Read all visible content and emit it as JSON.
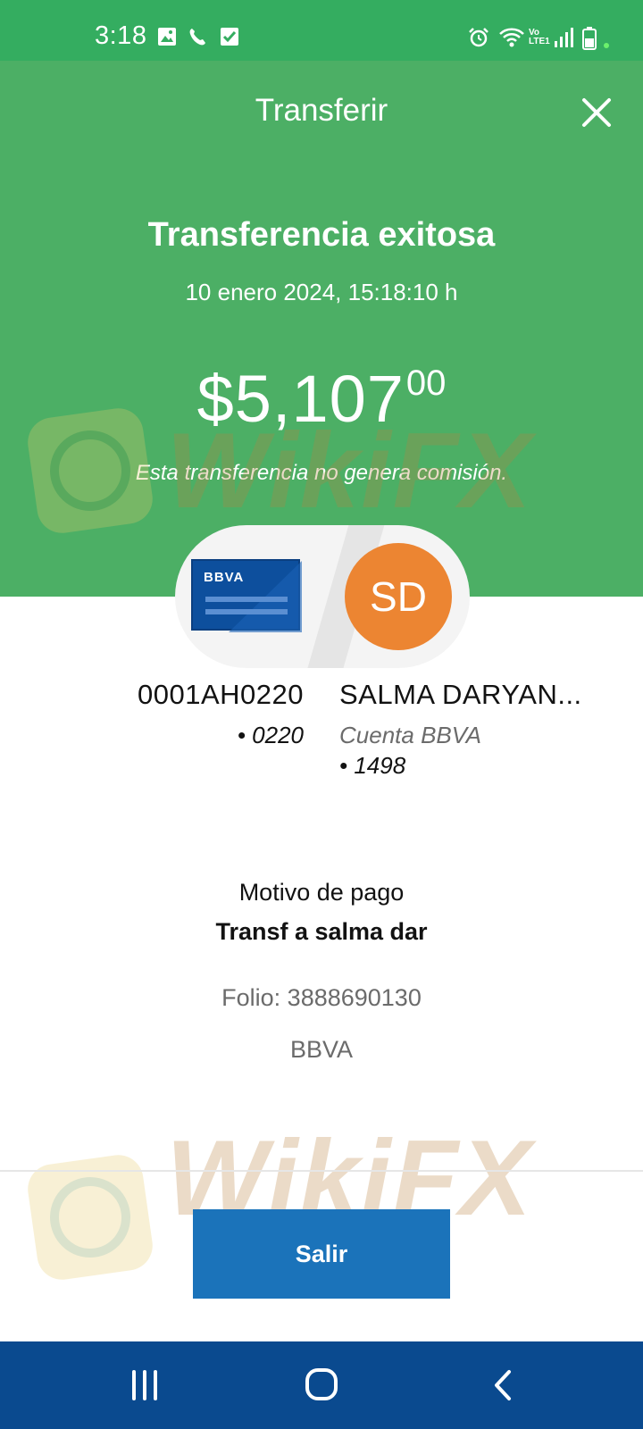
{
  "status_bar": {
    "time": "3:18",
    "icons": [
      "gallery-icon",
      "phone-icon",
      "checkbox-icon",
      "alarm-icon",
      "wifi-icon",
      "lte-icon",
      "signal-icon",
      "battery-icon"
    ],
    "lte_top": "Vo",
    "lte_bottom": "LTE1"
  },
  "header": {
    "title": "Transferir",
    "close_icon": "close-icon",
    "background": "#4caf65"
  },
  "result": {
    "title": "Transferencia exitosa",
    "date": "10 enero 2024, 15:18:10 h",
    "amount_main": "$5,107",
    "amount_cents": "00",
    "note": "Esta transferencia no genera comisión."
  },
  "origin": {
    "card_logo": "BBVA",
    "account": "0001AH0220",
    "last_digits": "• 0220"
  },
  "destination": {
    "initials": "SD",
    "name": "SALMA DARYAN...",
    "account_type": "Cuenta BBVA",
    "last_digits": "• 1498",
    "avatar_color": "#ec8532"
  },
  "details": {
    "motivo_label": "Motivo de pago",
    "motivo_value": "Transf a salma dar",
    "folio": "Folio: 3888690130",
    "bank": "BBVA"
  },
  "actions": {
    "exit_label": "Salir",
    "button_color": "#1b73ba"
  },
  "watermark": {
    "text": "WikiFX"
  },
  "nav_bar": {
    "buttons": [
      "recent-apps-icon",
      "home-icon",
      "back-icon"
    ]
  }
}
